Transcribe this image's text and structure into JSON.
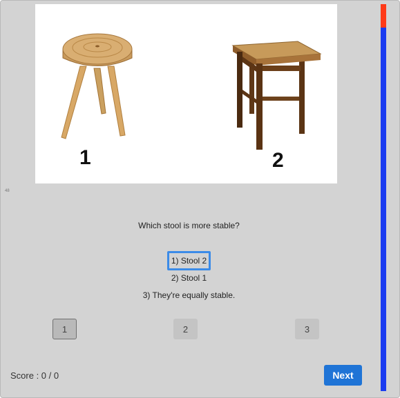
{
  "figure": {
    "number": "48",
    "stool_1_label": "1",
    "stool_2_label": "2"
  },
  "question": "Which stool is more stable?",
  "options": [
    {
      "label": "1) Stool 2",
      "selected": true
    },
    {
      "label": "2) Stool 1",
      "selected": false
    },
    {
      "label": "3) They're equally stable.",
      "selected": false
    }
  ],
  "answer_buttons": [
    {
      "label": "1",
      "active": true
    },
    {
      "label": "2",
      "active": false
    },
    {
      "label": "3",
      "active": false
    }
  ],
  "score_text": "Score : 0 / 0",
  "next_label": "Next",
  "progress": {
    "completed_fraction": 0.06,
    "completed_color": "#ff3a18",
    "remaining_color": "#1a3cf0"
  },
  "colors": {
    "background": "#d3d3d3",
    "selected_border": "#3b8be8",
    "next_button": "#1f74d6"
  },
  "icons": [
    "round-three-leg-stool-image",
    "square-four-leg-stool-image"
  ]
}
